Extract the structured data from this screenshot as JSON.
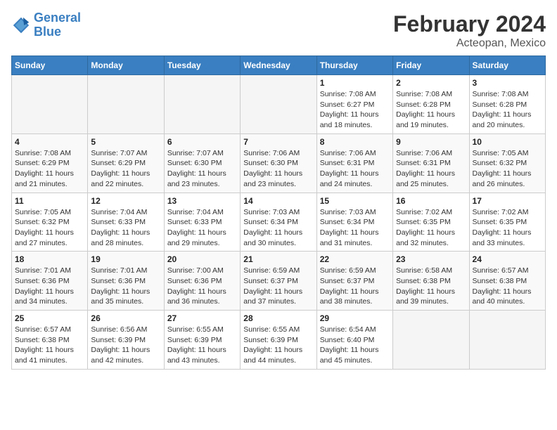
{
  "header": {
    "logo_line1": "General",
    "logo_line2": "Blue",
    "title": "February 2024",
    "subtitle": "Acteopan, Mexico"
  },
  "weekdays": [
    "Sunday",
    "Monday",
    "Tuesday",
    "Wednesday",
    "Thursday",
    "Friday",
    "Saturday"
  ],
  "weeks": [
    [
      {
        "day": "",
        "info": ""
      },
      {
        "day": "",
        "info": ""
      },
      {
        "day": "",
        "info": ""
      },
      {
        "day": "",
        "info": ""
      },
      {
        "day": "1",
        "info": "Sunrise: 7:08 AM\nSunset: 6:27 PM\nDaylight: 11 hours and 18 minutes."
      },
      {
        "day": "2",
        "info": "Sunrise: 7:08 AM\nSunset: 6:28 PM\nDaylight: 11 hours and 19 minutes."
      },
      {
        "day": "3",
        "info": "Sunrise: 7:08 AM\nSunset: 6:28 PM\nDaylight: 11 hours and 20 minutes."
      }
    ],
    [
      {
        "day": "4",
        "info": "Sunrise: 7:08 AM\nSunset: 6:29 PM\nDaylight: 11 hours and 21 minutes."
      },
      {
        "day": "5",
        "info": "Sunrise: 7:07 AM\nSunset: 6:29 PM\nDaylight: 11 hours and 22 minutes."
      },
      {
        "day": "6",
        "info": "Sunrise: 7:07 AM\nSunset: 6:30 PM\nDaylight: 11 hours and 23 minutes."
      },
      {
        "day": "7",
        "info": "Sunrise: 7:06 AM\nSunset: 6:30 PM\nDaylight: 11 hours and 23 minutes."
      },
      {
        "day": "8",
        "info": "Sunrise: 7:06 AM\nSunset: 6:31 PM\nDaylight: 11 hours and 24 minutes."
      },
      {
        "day": "9",
        "info": "Sunrise: 7:06 AM\nSunset: 6:31 PM\nDaylight: 11 hours and 25 minutes."
      },
      {
        "day": "10",
        "info": "Sunrise: 7:05 AM\nSunset: 6:32 PM\nDaylight: 11 hours and 26 minutes."
      }
    ],
    [
      {
        "day": "11",
        "info": "Sunrise: 7:05 AM\nSunset: 6:32 PM\nDaylight: 11 hours and 27 minutes."
      },
      {
        "day": "12",
        "info": "Sunrise: 7:04 AM\nSunset: 6:33 PM\nDaylight: 11 hours and 28 minutes."
      },
      {
        "day": "13",
        "info": "Sunrise: 7:04 AM\nSunset: 6:33 PM\nDaylight: 11 hours and 29 minutes."
      },
      {
        "day": "14",
        "info": "Sunrise: 7:03 AM\nSunset: 6:34 PM\nDaylight: 11 hours and 30 minutes."
      },
      {
        "day": "15",
        "info": "Sunrise: 7:03 AM\nSunset: 6:34 PM\nDaylight: 11 hours and 31 minutes."
      },
      {
        "day": "16",
        "info": "Sunrise: 7:02 AM\nSunset: 6:35 PM\nDaylight: 11 hours and 32 minutes."
      },
      {
        "day": "17",
        "info": "Sunrise: 7:02 AM\nSunset: 6:35 PM\nDaylight: 11 hours and 33 minutes."
      }
    ],
    [
      {
        "day": "18",
        "info": "Sunrise: 7:01 AM\nSunset: 6:36 PM\nDaylight: 11 hours and 34 minutes."
      },
      {
        "day": "19",
        "info": "Sunrise: 7:01 AM\nSunset: 6:36 PM\nDaylight: 11 hours and 35 minutes."
      },
      {
        "day": "20",
        "info": "Sunrise: 7:00 AM\nSunset: 6:36 PM\nDaylight: 11 hours and 36 minutes."
      },
      {
        "day": "21",
        "info": "Sunrise: 6:59 AM\nSunset: 6:37 PM\nDaylight: 11 hours and 37 minutes."
      },
      {
        "day": "22",
        "info": "Sunrise: 6:59 AM\nSunset: 6:37 PM\nDaylight: 11 hours and 38 minutes."
      },
      {
        "day": "23",
        "info": "Sunrise: 6:58 AM\nSunset: 6:38 PM\nDaylight: 11 hours and 39 minutes."
      },
      {
        "day": "24",
        "info": "Sunrise: 6:57 AM\nSunset: 6:38 PM\nDaylight: 11 hours and 40 minutes."
      }
    ],
    [
      {
        "day": "25",
        "info": "Sunrise: 6:57 AM\nSunset: 6:38 PM\nDaylight: 11 hours and 41 minutes."
      },
      {
        "day": "26",
        "info": "Sunrise: 6:56 AM\nSunset: 6:39 PM\nDaylight: 11 hours and 42 minutes."
      },
      {
        "day": "27",
        "info": "Sunrise: 6:55 AM\nSunset: 6:39 PM\nDaylight: 11 hours and 43 minutes."
      },
      {
        "day": "28",
        "info": "Sunrise: 6:55 AM\nSunset: 6:39 PM\nDaylight: 11 hours and 44 minutes."
      },
      {
        "day": "29",
        "info": "Sunrise: 6:54 AM\nSunset: 6:40 PM\nDaylight: 11 hours and 45 minutes."
      },
      {
        "day": "",
        "info": ""
      },
      {
        "day": "",
        "info": ""
      }
    ]
  ]
}
